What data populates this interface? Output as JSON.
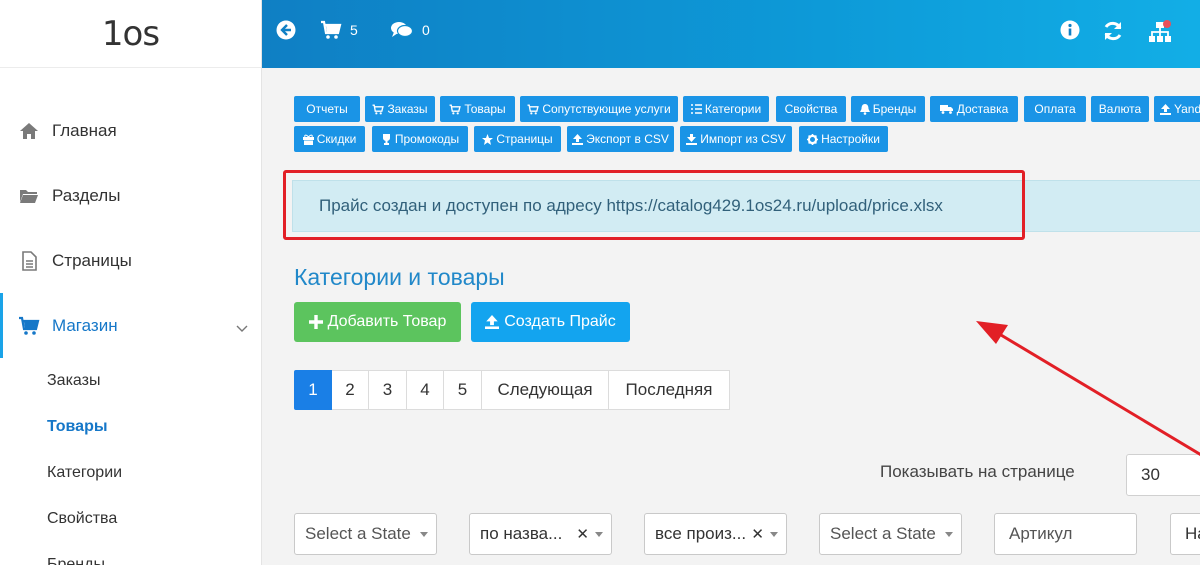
{
  "logo": {
    "text": "1os"
  },
  "topbar": {
    "cart_count": "5",
    "chat_count": "0"
  },
  "sidebar": {
    "items": [
      {
        "label": "Главная"
      },
      {
        "label": "Разделы"
      },
      {
        "label": "Страницы"
      },
      {
        "label": "Магазин"
      }
    ],
    "subitems": [
      {
        "label": "Заказы"
      },
      {
        "label": "Товары"
      },
      {
        "label": "Категории"
      },
      {
        "label": "Свойства"
      },
      {
        "label": "Бренды"
      }
    ]
  },
  "tabs": {
    "row1": [
      "Отчеты",
      "Заказы",
      "Товары",
      "Сопутствующие услуги",
      "Категории",
      "Свойства",
      "Бренды",
      "Доставка",
      "Оплата",
      "Валюта",
      "Yandex"
    ],
    "row2": [
      "Скидки",
      "Промокоды",
      "Страницы",
      "Экспорт в CSV",
      "Импорт из CSV",
      "Настройки"
    ]
  },
  "alert": {
    "text": "Прайс создан и доступен по адресу https://catalog429.1os24.ru/upload/price.xlsx"
  },
  "main": {
    "title": "Категории и товары",
    "add_button": "Добавить Товар",
    "price_button": "Создать Прайс"
  },
  "pagination": {
    "pages": [
      "1",
      "2",
      "3",
      "4",
      "5"
    ],
    "next": "Следующая",
    "last": "Последняя"
  },
  "perpage": {
    "label": "Показывать на странице",
    "value": "30"
  },
  "filters": {
    "state1": "Select a State",
    "name": "по назва...",
    "manufacturer": "все произ...",
    "state2": "Select a State",
    "article": "Артикул",
    "last": "На"
  },
  "colors": {
    "accent": "#1a94e6",
    "green": "#5cc45e",
    "red_annotation": "#e21f26"
  }
}
